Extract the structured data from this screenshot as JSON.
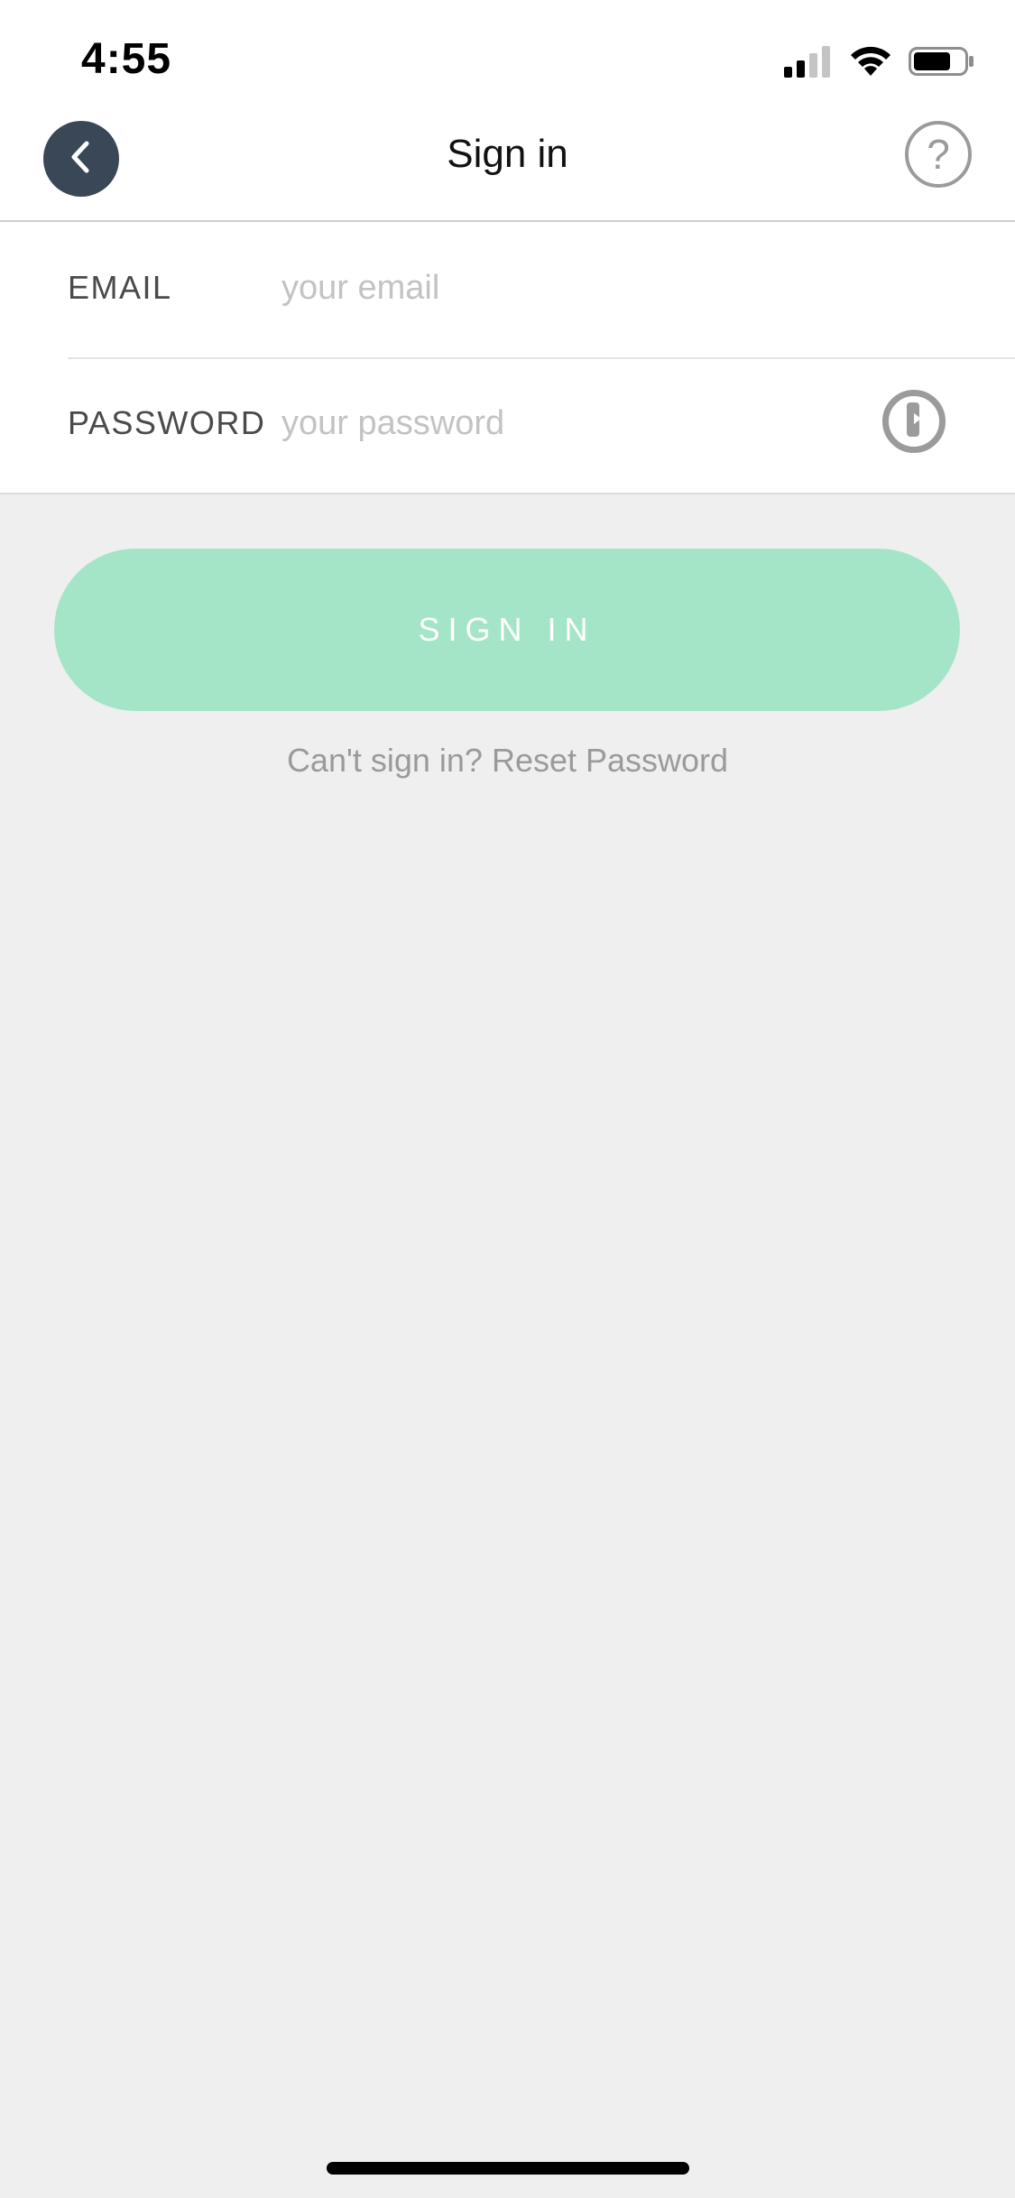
{
  "status_bar": {
    "time": "4:55",
    "icons": [
      "cellular-signal-icon",
      "wifi-icon",
      "battery-icon"
    ]
  },
  "nav": {
    "title": "Sign in",
    "back_icon": "chevron-left-icon",
    "help_label": "?"
  },
  "form": {
    "email": {
      "label": "EMAIL",
      "value": "",
      "placeholder": "your email"
    },
    "password": {
      "label": "PASSWORD",
      "value": "",
      "placeholder": "your password",
      "password_manager_icon": "onepassword-key-icon"
    }
  },
  "actions": {
    "sign_in_label": "SIGN IN",
    "reset_link": "Can't sign in? Reset Password"
  },
  "colors": {
    "primary_button": "#a5e5c7",
    "back_button": "#3a4757",
    "background": "#efefef"
  }
}
